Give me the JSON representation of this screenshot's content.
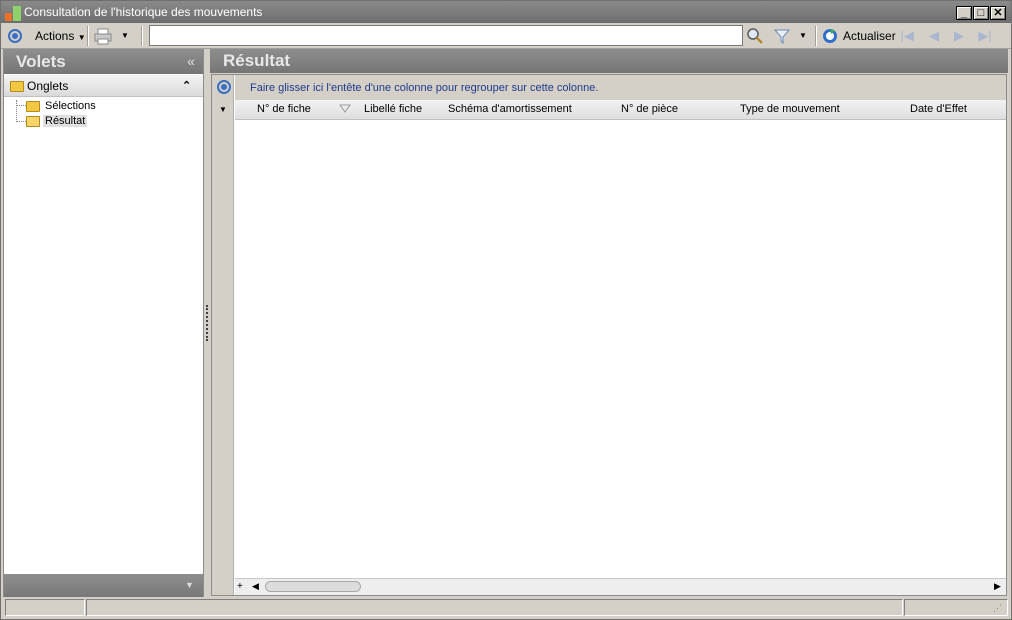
{
  "window": {
    "title": "Consultation de l'historique des mouvements",
    "buttons": {
      "minimize": "_",
      "maximize": "□",
      "close": "✕"
    }
  },
  "toolbar": {
    "actions_label": "Actions",
    "search_value": "",
    "refresh_label": "Actualiser"
  },
  "left_panel": {
    "title": "Volets",
    "collapse_glyph": "«",
    "group_label": "Onglets",
    "group_toggle_glyph": "⌃",
    "tree_items": [
      {
        "label": "Sélections",
        "selected": false
      },
      {
        "label": "Résultat",
        "selected": true
      }
    ]
  },
  "result_panel": {
    "title": "Résultat",
    "group_hint": "Faire glisser ici l'entête d'une colonne pour regrouper sur cette colonne.",
    "columns": [
      "N° de fiche",
      "Libellé fiche",
      "Schéma d'amortissement",
      "N° de pièce",
      "Type de mouvement",
      "Date d'Effet"
    ],
    "rows": []
  },
  "colors": {
    "header_gradient_top": "#8e8e8e",
    "header_gradient_bottom": "#757575",
    "accent_blue": "#3a6fc4",
    "hint_text": "#1f3a8a"
  },
  "icons": [
    "app-icon",
    "actions-ring-icon",
    "print-icon",
    "dropdown-arrow-icon",
    "search-icon",
    "filter-icon",
    "refresh-icon",
    "first-record-icon",
    "previous-record-icon",
    "next-record-icon",
    "last-record-icon",
    "folder-icon",
    "open-folder-icon",
    "collapse-panel-icon",
    "grid-options-icon",
    "sort-indicator-icon",
    "resize-grip-icon"
  ]
}
